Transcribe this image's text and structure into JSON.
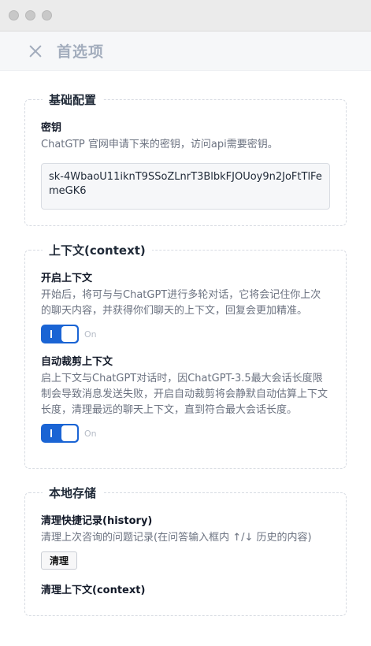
{
  "window": {
    "title": "首选项"
  },
  "sections": {
    "basic": {
      "legend": "基础配置",
      "key": {
        "label": "密钥",
        "description": "ChatGTP 官网申请下来的密钥，访问api需要密钥。",
        "value": "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"
      }
    },
    "context": {
      "legend": "上下文(context)",
      "enable": {
        "label": "开启上下文",
        "description": "开始后，将可与与ChatGPT进行多轮对话，它将会记住你上次的聊天内容，并获得你们聊天的上下文，回复会更加精准。",
        "toggle_text": "On"
      },
      "auto_trim": {
        "label": "自动裁剪上下文",
        "description": "启上下文与ChatGPT对话时，因ChatGPT-3.5最大会话长度限制会导致消息发送失败，开启自动裁剪将会静默自动估算上下文长度，清理最远的聊天上下文，直到符合最大会话长度。",
        "toggle_text": "On"
      }
    },
    "storage": {
      "legend": "本地存储",
      "history": {
        "label": "清理快捷记录(history)",
        "description": "清理上次咨询的问题记录(在问答输入框内 ↑/↓ 历史的内容)",
        "button": "清理"
      },
      "context": {
        "label": "清理上下文(context)"
      }
    }
  }
}
